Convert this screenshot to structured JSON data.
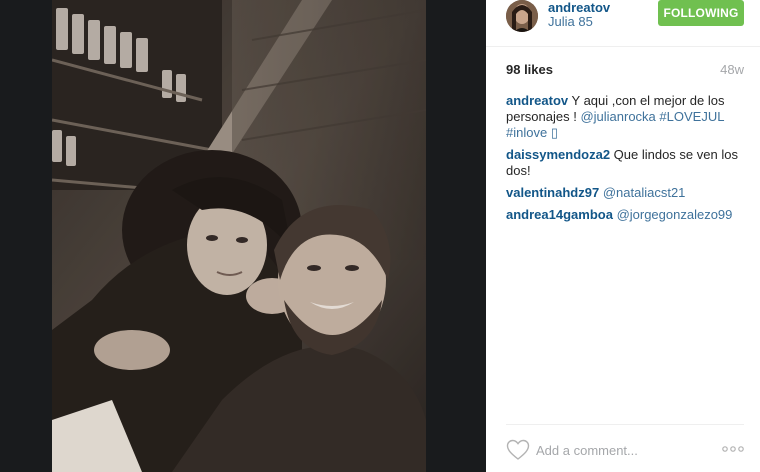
{
  "post": {
    "username": "andreatov",
    "location": "Julia 85",
    "follow_label": "FOLLOWING",
    "likes": "98 likes",
    "age": "48w"
  },
  "comments": [
    {
      "user": "andreatov",
      "parts": [
        {
          "text": " Y aqui ,con el mejor de los personajes ! ",
          "link": false
        },
        {
          "text": "@julianrocka",
          "link": true
        },
        {
          "text": " ",
          "link": false
        },
        {
          "text": "#LOVEJUL",
          "link": true
        },
        {
          "text": " ",
          "link": false
        },
        {
          "text": "#inlove",
          "link": true
        },
        {
          "text": " ",
          "link": false
        }
      ],
      "trailing_glyph": "▯"
    },
    {
      "user": "daissymendoza2",
      "parts": [
        {
          "text": " Que lindos se ven los dos!",
          "link": false
        }
      ]
    },
    {
      "user": "valentinahdz97",
      "parts": [
        {
          "text": " ",
          "link": false
        },
        {
          "text": "@nataliacst21",
          "link": true
        }
      ]
    },
    {
      "user": "andrea14gamboa",
      "parts": [
        {
          "text": " ",
          "link": false
        },
        {
          "text": "@jorgegonzalezo99",
          "link": true
        }
      ]
    }
  ],
  "footer": {
    "comment_placeholder": "Add a comment...",
    "like_icon": "heart-outline-icon",
    "more_icon": "ellipsis-icon"
  },
  "colors": {
    "username": "#125688",
    "link": "#3f729b",
    "follow_button": "#70c050",
    "muted": "#a5a7aa",
    "backdrop": "#191b1d"
  }
}
